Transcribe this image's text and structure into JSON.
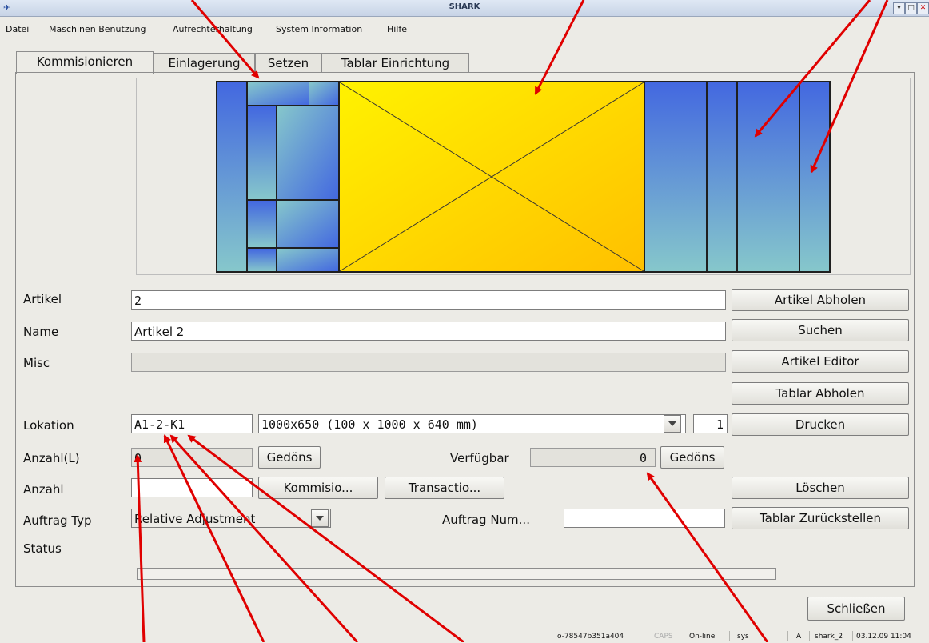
{
  "window": {
    "title": "SHARK",
    "controls": [
      "▾",
      "□",
      "✕"
    ]
  },
  "menu": [
    "Datei",
    "Maschinen Benutzung",
    "Aufrechterhaltung",
    "System Information",
    "Hilfe"
  ],
  "tabs": [
    "Kommisionieren",
    "Einlagerung",
    "Setzen",
    "Tablar Einrichtung"
  ],
  "form": {
    "artikel_label": "Artikel",
    "artikel_value": "2",
    "artikel_button": "Artikel Abholen",
    "name_label": "Name",
    "name_value": "Artikel 2",
    "name_button": "Suchen",
    "misc_label": "Misc",
    "misc_value": "",
    "misc_button": "Artikel Editor",
    "tablar_button": "Tablar Abholen",
    "lokation_label": "Lokation",
    "lokation_value": "A1-2-K1",
    "tray_select": "1000x650 (100 x 1000 x 640 mm)",
    "copies_value": "1",
    "print_button": "Drucken",
    "anzahl_l_label": "Anzahl(L)",
    "anzahl_l_value": "0",
    "gedoens_1": "Gedöns",
    "verfuegbar_label": "Verfügbar",
    "verfuegbar_value": "0",
    "gedoens_2": "Gedöns",
    "anzahl_label": "Anzahl",
    "anzahl_value": "",
    "kommission_button": "Kommisio...",
    "transaction_button": "Transactio...",
    "loeschen_button": "Löschen",
    "auftrag_typ_label": "Auftrag Typ",
    "auftrag_typ_value": "Relative Adjustment",
    "auftrag_num_label": "Auftrag Num...",
    "auftrag_num_value": "",
    "zurueck_button": "Tablar Zurückstellen",
    "status_label": "Status",
    "close_button": "Schließen"
  },
  "statusbar": [
    "o-78547b351a404",
    "CAPS",
    "On-line",
    "sys",
    "A",
    "shark_2",
    "03.12.09 11:04"
  ],
  "colors": {
    "tray_blue": "#4a6fdc",
    "tray_teal": "#7fc3cc",
    "yellow_start": "#fff200",
    "yellow_end": "#ffc400",
    "arrow_red": "#e00000"
  }
}
